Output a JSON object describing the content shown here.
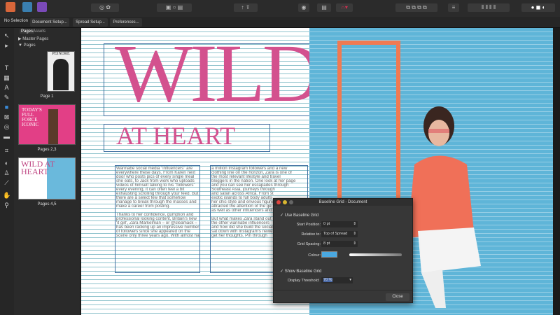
{
  "toolbar": {
    "personas": [
      "publisher-persona",
      "designer-persona",
      "photo-persona"
    ]
  },
  "context": {
    "selection": "No Selection",
    "buttons": [
      "Document Setup...",
      "Spread Setup...",
      "Preferences..."
    ]
  },
  "panel": {
    "tabs": [
      "Pages",
      "Assets"
    ],
    "master_pages": "Master Pages",
    "pages": "Pages",
    "thumbnails": [
      {
        "label": "Page 1",
        "title": "PEINDRE"
      },
      {
        "label": "Pages 2,3",
        "title": "TODAY'S FULL FORCE ICONIC"
      },
      {
        "label": "Pages 4,5",
        "title": "WILD AT HEART"
      }
    ]
  },
  "document": {
    "headline": "WILD",
    "subhead": "AT HEART",
    "col1": [
      "Wannabe social media \"influencers\" are",
      "everywhere these days. From Karen next",
      "door who posts pics of every single meal",
      "she eats, to Jack from work who uploads",
      "videos of himself talking to his \"followers\"",
      "every evening, it can often feel a bit",
      "exhausting scrolling through your feed. But",
      "there are a select few that somehow",
      "manage to break through the masses and",
      "make a career from posting.",
      "",
      "Thanks to her confidence, gumption and",
      "professional looking content, Britain's new",
      "'it girl', Zara Markelman – or @sleamack –",
      "has been racking up an impressive number",
      "of followers since she appeared on the",
      "scene only three years ago. With almost half"
    ],
    "col2": [
      "a million Instagram followers and a new",
      "clothing line on the horizon, Zara is one of",
      "the most relevant lifestyle and travel",
      "bloggers in the nation. One look at her page",
      "and you can see her escapades through",
      "Southeast Asia, journeys through",
      "and safari across Africa. From st",
      "exotic islands to full body adults",
      "her chic style and envious figure",
      "attracted the attention of the ge",
      "as well as other influencers and",
      "",
      "But what makes Zara stand out",
      "the other wannabe influencers",
      "and how did she build the social",
      "sat down with Instagram's newe",
      "get her thoughts. Pin through"
    ]
  },
  "dialog": {
    "title": "Baseline Grid - Document",
    "use_baseline": "Use Baseline Grid",
    "start_label": "Start Position:",
    "start_value": "0 pt",
    "relative_label": "Relative to:",
    "relative_value": "Top of Spread",
    "spacing_label": "Grid Spacing:",
    "spacing_value": "8 pt",
    "colour_label": "Colour:",
    "colour": "#4aa8e0",
    "show_grid": "Show Baseline Grid",
    "threshold_label": "Display Threshold:",
    "threshold_value": "70 %",
    "close": "Close"
  }
}
